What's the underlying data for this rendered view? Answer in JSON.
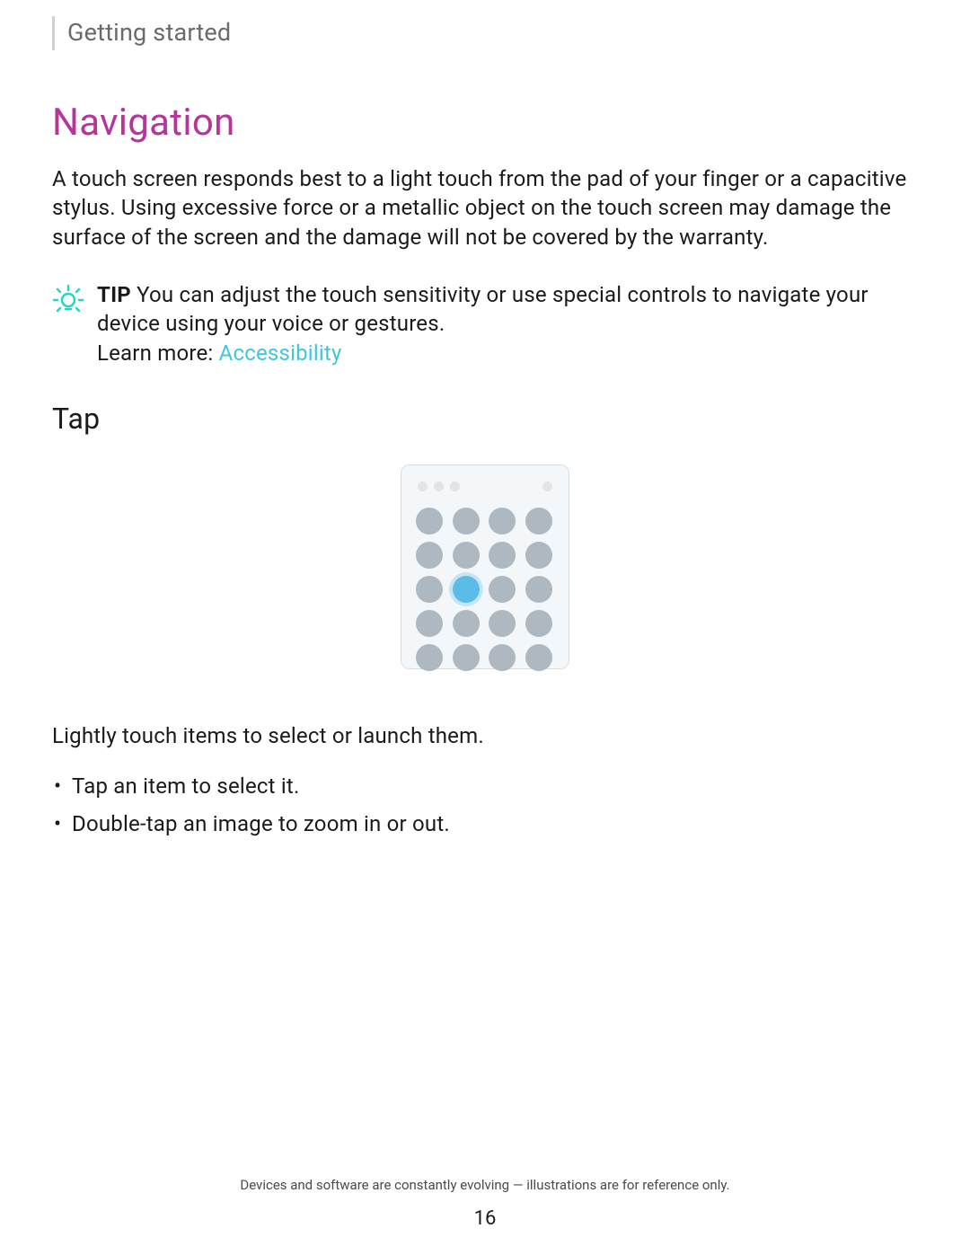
{
  "breadcrumb": "Getting started",
  "heading": "Navigation",
  "intro_paragraph": "A touch screen responds best to a light touch from the pad of your finger or a capacitive stylus. Using excessive force or a metallic object on the touch screen may damage the surface of the screen and the damage will not be covered by the warranty.",
  "tip": {
    "label": "TIP",
    "text": "You can adjust the touch sensitivity or use special controls to navigate your device using your voice or gestures.",
    "learn_more_label": "Learn more:",
    "learn_more_link": "Accessibility"
  },
  "section": {
    "heading": "Tap",
    "caption": "Lightly touch items to select or launch them.",
    "bullets": [
      "Tap an item to select it.",
      "Double-tap an image to zoom in or out."
    ]
  },
  "footer": {
    "note": "Devices and software are constantly evolving — illustrations are for reference only.",
    "page_number": "16"
  }
}
